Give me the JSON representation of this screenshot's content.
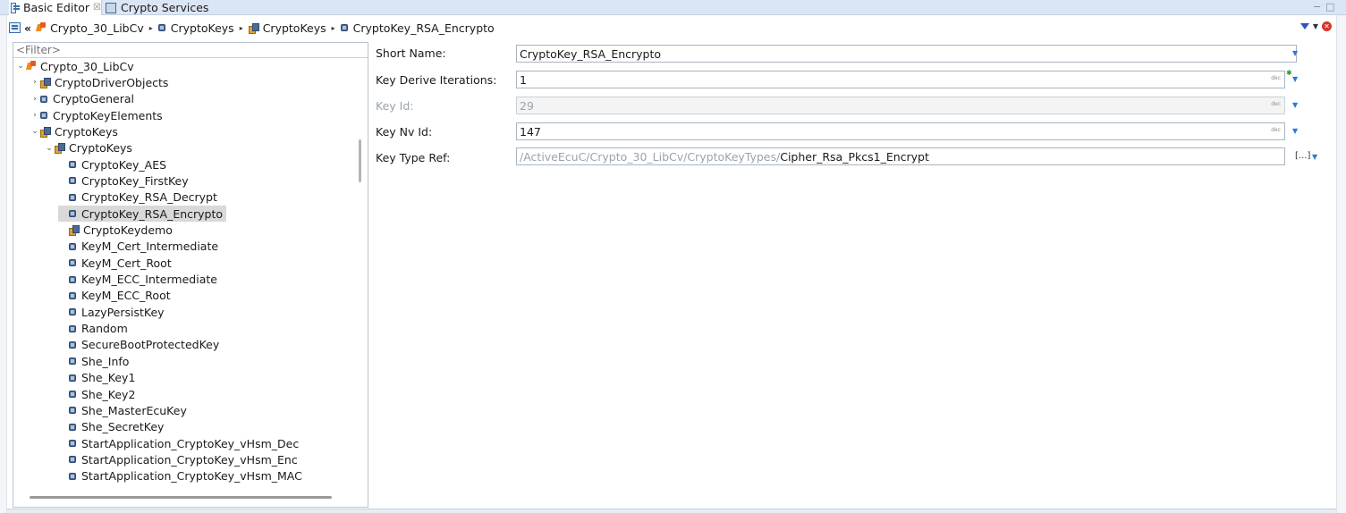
{
  "tabs": [
    {
      "label": "Basic Editor",
      "icon": "editor-icon",
      "close": "☒"
    },
    {
      "label": "Crypto Services",
      "icon": "services-icon"
    }
  ],
  "breadcrumb": {
    "back": "«",
    "separator": "▸",
    "items": [
      "Crypto_30_LibCv",
      "CryptoKeys",
      "CryptoKeys",
      "CryptoKey_RSA_Encrypto"
    ]
  },
  "window_controls": {
    "minimize": "−",
    "maximize": "□"
  },
  "tree": {
    "filter_placeholder": "<Filter>",
    "root": "Crypto_30_LibCv",
    "items": [
      {
        "label": "CryptoDriverObjects",
        "icon": "group",
        "twisty": "›"
      },
      {
        "label": "CryptoGeneral",
        "icon": "node",
        "twisty": "›"
      },
      {
        "label": "CryptoKeyElements",
        "icon": "node",
        "twisty": "›"
      },
      {
        "label": "CryptoKeys",
        "icon": "group",
        "twisty": "⌄"
      },
      {
        "label": "CryptoKeys",
        "icon": "group",
        "twisty": "⌄"
      },
      {
        "label": "CryptoKey_AES",
        "icon": "node"
      },
      {
        "label": "CryptoKey_FirstKey",
        "icon": "node"
      },
      {
        "label": "CryptoKey_RSA_Decrypt",
        "icon": "node"
      },
      {
        "label": "CryptoKey_RSA_Encrypto",
        "icon": "node",
        "selected": true
      },
      {
        "label": "CryptoKeydemo",
        "icon": "group"
      },
      {
        "label": "KeyM_Cert_Intermediate",
        "icon": "node"
      },
      {
        "label": "KeyM_Cert_Root",
        "icon": "node"
      },
      {
        "label": "KeyM_ECC_Intermediate",
        "icon": "node"
      },
      {
        "label": "KeyM_ECC_Root",
        "icon": "node"
      },
      {
        "label": "LazyPersistKey",
        "icon": "node"
      },
      {
        "label": "Random",
        "icon": "node"
      },
      {
        "label": "SecureBootProtectedKey",
        "icon": "node"
      },
      {
        "label": "She_Info",
        "icon": "node"
      },
      {
        "label": "She_Key1",
        "icon": "node"
      },
      {
        "label": "She_Key2",
        "icon": "node"
      },
      {
        "label": "She_MasterEcuKey",
        "icon": "node"
      },
      {
        "label": "She_SecretKey",
        "icon": "node"
      },
      {
        "label": "StartApplication_CryptoKey_vHsm_Dec",
        "icon": "node"
      },
      {
        "label": "StartApplication_CryptoKey_vHsm_Enc",
        "icon": "node"
      },
      {
        "label": "StartApplication_CryptoKey_vHsm_MAC",
        "icon": "node"
      }
    ]
  },
  "form": {
    "short_name": {
      "label": "Short Name:",
      "value": "CryptoKey_RSA_Encrypto"
    },
    "key_derive_iterations": {
      "label": "Key Derive Iterations:",
      "value": "1",
      "badge": "dec"
    },
    "key_id": {
      "label": "Key Id:",
      "value": "29",
      "badge": "dec"
    },
    "key_nv_id": {
      "label": "Key Nv Id:",
      "value": "147",
      "badge": "dec"
    },
    "key_type_ref": {
      "label": "Key Type Ref:",
      "prefix": "/ActiveEcuC/Crypto_30_LibCv/CryptoKeyTypes/",
      "suffix": "Cipher_Rsa_Pkcs1_Encrypt",
      "button": "[...]"
    }
  },
  "colors": {
    "accent": "#2a7ad6",
    "selection": "#d9d9d9",
    "tab_bar": "#dbe6f4"
  }
}
